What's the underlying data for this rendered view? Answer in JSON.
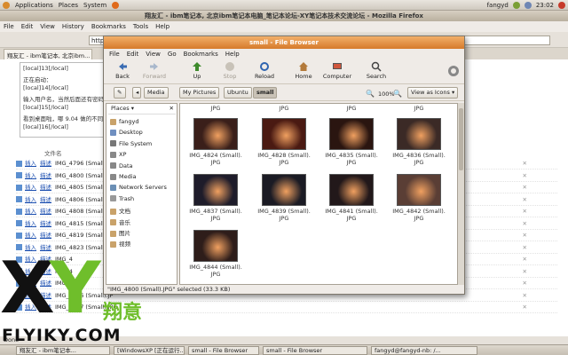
{
  "top_panel": {
    "menus": [
      "Applications",
      "Places",
      "System"
    ],
    "user": "fangyd",
    "time": "23:02"
  },
  "firefox": {
    "title": "翔友汇 - ibm笔记本, 北京ibm笔记本电脑_笔记本论坛-XY笔记本技术交流论坛 - Mozilla Firefox",
    "menus": [
      "File",
      "Edit",
      "View",
      "History",
      "Bookmarks",
      "Tools",
      "Help"
    ],
    "url": "http:",
    "tab": "翔友汇 - ibm笔记本, 北京ibm...",
    "log_lines": [
      "[local]13[/local]",
      "正在启动：",
      "[local]14[/local]",
      "输入用户名，当然后面还有密码",
      "[local]15[/local]",
      "看到桌面啦，哪 9.04 做的不同",
      "[local]16[/local]"
    ],
    "file_header": "文件名",
    "insert_label": "插入",
    "describe_label": "描述",
    "files": [
      "IMG_4796 (Small).JP",
      "IMG_4800 (Small).JP",
      "IMG_4805 (Small).JP",
      "IMG_4806 (Small).JP",
      "IMG_4808 (Small).JP",
      "IMG_4815 (Small).JP",
      "IMG_4819 (Small).JP",
      "IMG_4823 (Small).JP",
      "IMG_4",
      "IMG_4",
      "IMG_4",
      "IMG_4836 (Small).JP",
      "IMG_4837 (Small).JPG"
    ],
    "status": "Done"
  },
  "file_browser": {
    "title": "small - File Browser",
    "menus": [
      "File",
      "Edit",
      "View",
      "Go",
      "Bookmarks",
      "Help"
    ],
    "toolbar": {
      "back": "Back",
      "forward": "Forward",
      "up": "Up",
      "stop": "Stop",
      "reload": "Reload",
      "home": "Home",
      "computer": "Computer",
      "search": "Search"
    },
    "breadcrumbs": [
      "Media",
      "My Pictures",
      "Ubuntu",
      "small"
    ],
    "zoom": "100%",
    "view_mode": "View as Icons",
    "places_label": "Places",
    "places": [
      "fangyd",
      "Desktop",
      "File System",
      "XP",
      "Data",
      "Media",
      "Network Servers",
      "Trash",
      "文档",
      "音乐",
      "图片",
      "视频"
    ],
    "top_captions": [
      "JPG",
      "JPG",
      "JPG",
      "JPG"
    ],
    "icons": [
      {
        "label": "IMG_4824 (Small).\nJPG",
        "color": "#3a1f1a"
      },
      {
        "label": "IMG_4828 (Small).\nJPG",
        "color": "#4a1a12"
      },
      {
        "label": "IMG_4835 (Small).\nJPG",
        "color": "#2a1510"
      },
      {
        "label": "IMG_4836 (Small).\nJPG",
        "color": "#3b2a26"
      },
      {
        "label": "IMG_4837 (Small).\nJPG",
        "color": "#1e1c2a"
      },
      {
        "label": "IMG_4839 (Small).\nJPG",
        "color": "#1b1b24"
      },
      {
        "label": "IMG_4841 (Small).\nJPG",
        "color": "#22181a"
      },
      {
        "label": "IMG_4842 (Small).\nJPG",
        "color": "#5a3e35"
      },
      {
        "label": "IMG_4844 (Small).\nJPG",
        "color": "#2e1d1a"
      }
    ],
    "status": "\"IMG_4800 (Small).JPG\" selected (33.3 KB)"
  },
  "taskbar": [
    "翔友汇 - ibm笔记本...",
    "[WindowsXP [正在运行...",
    "small - File Browser",
    "small - File Browser",
    "fangyd@fangyd-nb: /..."
  ],
  "watermark": {
    "x": "X",
    "y": "Y",
    "cn": "翔意",
    "url": "FLYIKY.COM"
  }
}
